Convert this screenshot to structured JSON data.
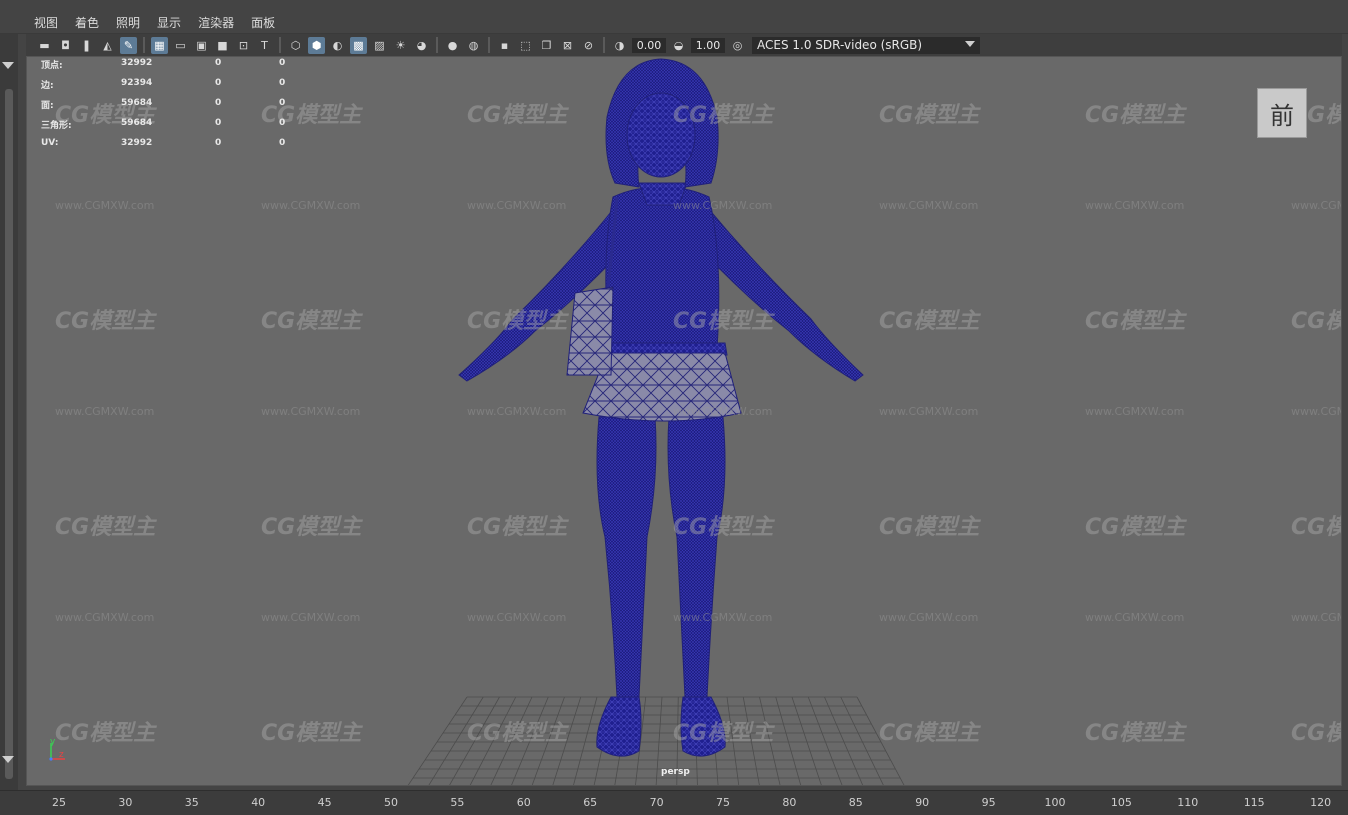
{
  "menu": [
    "视图",
    "着色",
    "照明",
    "显示",
    "渲染器",
    "面板"
  ],
  "toolbar": {
    "icons": [
      "camera-icon",
      "camera-attributes-icon",
      "bookmark-icon",
      "image-plane-icon",
      "paint-icon",
      "grid-icon",
      "film-gate-icon",
      "resolution-gate-icon",
      "gate-mask-icon",
      "safe-action-icon",
      "safe-title-icon",
      "wireframe-cube-icon",
      "smooth-shade-icon",
      "default-material-icon",
      "wireframe-on-shaded-icon",
      "textured-icon",
      "use-all-lights-icon",
      "shadows-icon",
      "ambient-occlusion-icon",
      "motion-blur-icon",
      "anti-aliasing-icon",
      "isolate-select-icon",
      "xray-icon",
      "xray-joints-icon",
      "backface-culling-icon",
      "exposure-icon",
      "gamma-icon",
      "color-management-icon"
    ],
    "exposure": "0.00",
    "gamma": "1.00",
    "color_space": "ACES 1.0 SDR-video (sRGB)"
  },
  "hud": {
    "rows": [
      {
        "label": "顶点:",
        "v1": "32992",
        "v2": "0",
        "v3": "0"
      },
      {
        "label": "边:",
        "v1": "92394",
        "v2": "0",
        "v3": "0"
      },
      {
        "label": "面:",
        "v1": "59684",
        "v2": "0",
        "v3": "0"
      },
      {
        "label": "三角形:",
        "v1": "59684",
        "v2": "0",
        "v3": "0"
      },
      {
        "label": "UV:",
        "v1": "32992",
        "v2": "0",
        "v3": "0"
      }
    ]
  },
  "viewcube_label": "前",
  "camera": "persp",
  "axis_labels": {
    "y": "y",
    "z": "z"
  },
  "watermark": {
    "logo": "CG模型主",
    "url": "www.CGMXW.com"
  },
  "timeline_ticks": [
    "25",
    "30",
    "35",
    "40",
    "45",
    "50",
    "55",
    "60",
    "65",
    "70",
    "75",
    "80",
    "85",
    "90",
    "95",
    "100",
    "105",
    "110",
    "115",
    "120"
  ],
  "colors": {
    "viewport_bg": "#696969",
    "wire": "#1a1a8a",
    "grid": "#4c4c4c",
    "active_tool": "#5d7b96"
  }
}
